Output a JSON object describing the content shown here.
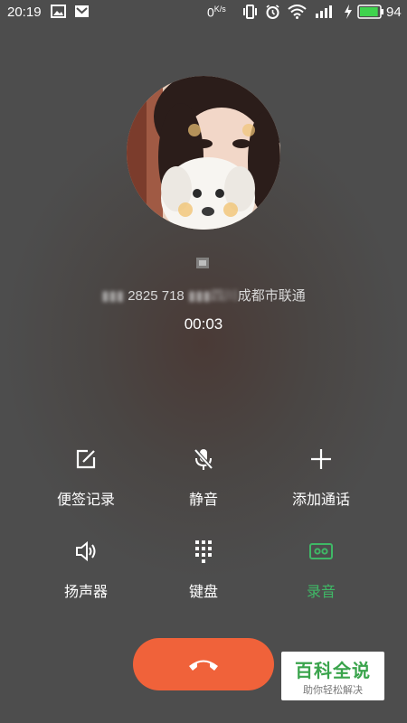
{
  "status_bar": {
    "time": "20:19",
    "net_speed": "0",
    "net_speed_unit": "K/s",
    "battery_level": "94",
    "battery_percent": 94,
    "icons": [
      "image-notification-icon",
      "mail-notification-icon",
      "vibrate-icon",
      "alarm-icon",
      "wifi-icon",
      "signal-icon",
      "charging-icon",
      "battery-icon"
    ]
  },
  "caller": {
    "avatar_icon": "contact-photo",
    "number": "2825 718",
    "location": "成都市联通",
    "duration": "00:03"
  },
  "actions": [
    {
      "label": "便签记录",
      "icon": "note-icon",
      "active": false
    },
    {
      "label": "静音",
      "icon": "mic-off-icon",
      "active": false
    },
    {
      "label": "添加通话",
      "icon": "plus-icon",
      "active": false
    },
    {
      "label": "扬声器",
      "icon": "speaker-icon",
      "active": false
    },
    {
      "label": "键盘",
      "icon": "dialpad-icon",
      "active": false
    },
    {
      "label": "录音",
      "icon": "record-icon",
      "active": true
    }
  ],
  "end_call": {
    "icon": "hang-up-icon"
  },
  "watermark": {
    "title": "百科全说",
    "subtitle": "助你轻松解决"
  },
  "colors": {
    "accent_green": "#3fb866",
    "end_call": "#f0623a",
    "background": "#4d4d4d"
  }
}
